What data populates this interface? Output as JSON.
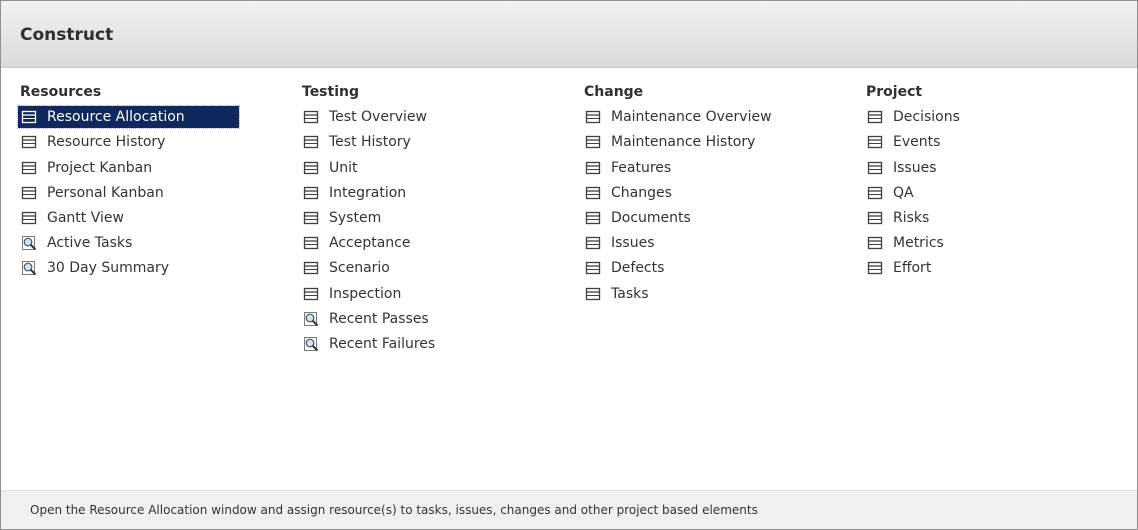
{
  "header": {
    "title": "Construct"
  },
  "columns": [
    {
      "heading": "Resources",
      "items": [
        {
          "label": "Resource Allocation",
          "icon": "table-icon",
          "selected": true
        },
        {
          "label": "Resource History",
          "icon": "table-icon"
        },
        {
          "label": "Project Kanban",
          "icon": "table-icon"
        },
        {
          "label": "Personal Kanban",
          "icon": "table-icon"
        },
        {
          "label": "Gantt View",
          "icon": "table-icon"
        },
        {
          "label": "Active Tasks",
          "icon": "search-icon"
        },
        {
          "label": "30 Day Summary",
          "icon": "search-icon"
        }
      ]
    },
    {
      "heading": "Testing",
      "items": [
        {
          "label": "Test Overview",
          "icon": "table-icon"
        },
        {
          "label": "Test History",
          "icon": "table-icon"
        },
        {
          "label": "Unit",
          "icon": "table-icon"
        },
        {
          "label": "Integration",
          "icon": "table-icon"
        },
        {
          "label": "System",
          "icon": "table-icon"
        },
        {
          "label": "Acceptance",
          "icon": "table-icon"
        },
        {
          "label": "Scenario",
          "icon": "table-icon"
        },
        {
          "label": "Inspection",
          "icon": "table-icon"
        },
        {
          "label": "Recent Passes",
          "icon": "search-icon"
        },
        {
          "label": "Recent Failures",
          "icon": "search-icon"
        }
      ]
    },
    {
      "heading": "Change",
      "items": [
        {
          "label": "Maintenance Overview",
          "icon": "table-icon"
        },
        {
          "label": "Maintenance History",
          "icon": "table-icon"
        },
        {
          "label": "Features",
          "icon": "table-icon"
        },
        {
          "label": "Changes",
          "icon": "table-icon"
        },
        {
          "label": "Documents",
          "icon": "table-icon"
        },
        {
          "label": "Issues",
          "icon": "table-icon"
        },
        {
          "label": "Defects",
          "icon": "table-icon"
        },
        {
          "label": "Tasks",
          "icon": "table-icon"
        }
      ]
    },
    {
      "heading": "Project",
      "items": [
        {
          "label": "Decisions",
          "icon": "table-icon"
        },
        {
          "label": "Events",
          "icon": "table-icon"
        },
        {
          "label": "Issues",
          "icon": "table-icon"
        },
        {
          "label": "QA",
          "icon": "table-icon"
        },
        {
          "label": "Risks",
          "icon": "table-icon"
        },
        {
          "label": "Metrics",
          "icon": "table-icon"
        },
        {
          "label": "Effort",
          "icon": "table-icon"
        }
      ]
    }
  ],
  "status": {
    "text": "Open the Resource Allocation window and assign resource(s) to tasks, issues, changes and other project based elements"
  },
  "colors": {
    "selection": "#10285e",
    "header": "#e6e6e6"
  }
}
